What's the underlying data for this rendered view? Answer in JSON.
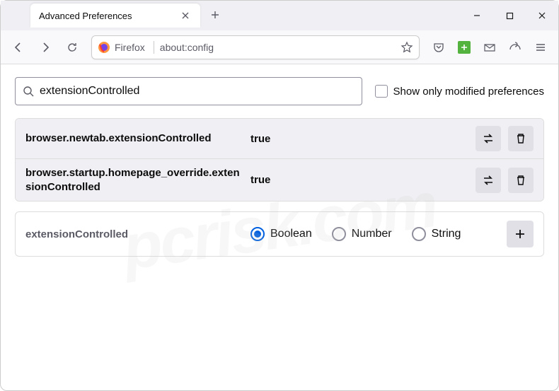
{
  "window": {
    "tab_title": "Advanced Preferences"
  },
  "toolbar": {
    "identity": "Firefox",
    "url": "about:config"
  },
  "search": {
    "value": "extensionControlled",
    "checkbox_label": "Show only modified preferences"
  },
  "prefs": [
    {
      "name": "browser.newtab.extensionControlled",
      "value": "true"
    },
    {
      "name": "browser.startup.homepage_override.extensionControlled",
      "value": "true"
    }
  ],
  "new_pref": {
    "name": "extensionControlled",
    "types": [
      "Boolean",
      "Number",
      "String"
    ],
    "selected": 0
  },
  "watermark": "pcrisk.com"
}
